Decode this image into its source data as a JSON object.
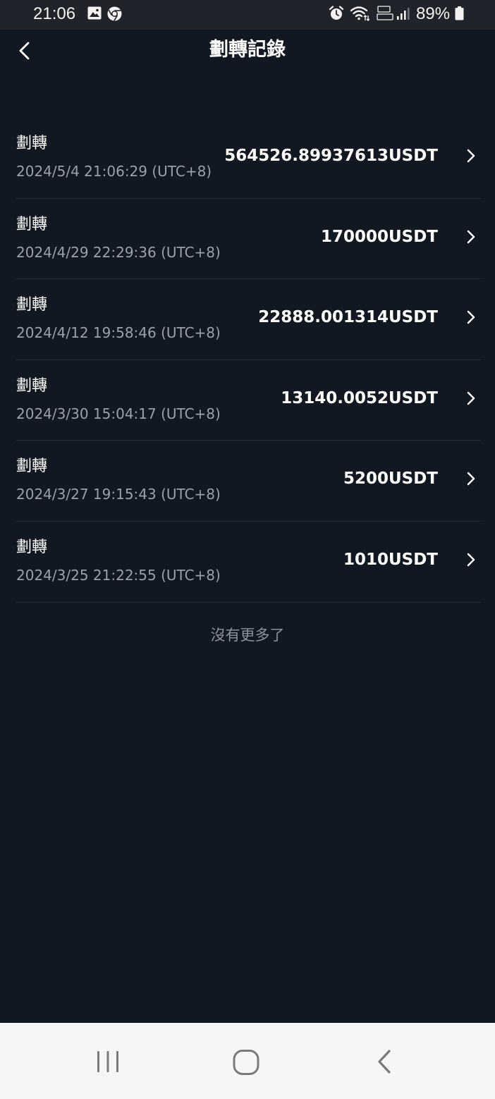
{
  "status_bar": {
    "time": "21:06",
    "battery": "89%",
    "icons": [
      "gallery-icon",
      "chrome-icon",
      "alarm-icon",
      "wifi-icon",
      "volte-lte1-icon",
      "signal-icon",
      "battery-icon"
    ]
  },
  "header": {
    "title": "劃轉記錄",
    "back_icon": "chevron-left-icon"
  },
  "records": [
    {
      "type": "劃轉",
      "time": "2024/5/4 21:06:29 (UTC+8)",
      "amount": "564526.89937613USDT"
    },
    {
      "type": "劃轉",
      "time": "2024/4/29 22:29:36 (UTC+8)",
      "amount": "170000USDT"
    },
    {
      "type": "劃轉",
      "time": "2024/4/12 19:58:46 (UTC+8)",
      "amount": "22888.001314USDT"
    },
    {
      "type": "劃轉",
      "time": "2024/3/30 15:04:17 (UTC+8)",
      "amount": "13140.0052USDT"
    },
    {
      "type": "劃轉",
      "time": "2024/3/27 19:15:43 (UTC+8)",
      "amount": "5200USDT"
    },
    {
      "type": "劃轉",
      "time": "2024/3/25 21:22:55 (UTC+8)",
      "amount": "1010USDT"
    }
  ],
  "list_end_text": "沒有更多了",
  "nav_bar": {
    "icons": [
      "recent-apps-icon",
      "home-icon",
      "back-icon"
    ]
  },
  "colors": {
    "background": "#121821",
    "status_bar": "#20242a",
    "divider": "#272d37",
    "secondary_text": "#9aa1ab",
    "nav_bar": "#f6f6f6"
  }
}
